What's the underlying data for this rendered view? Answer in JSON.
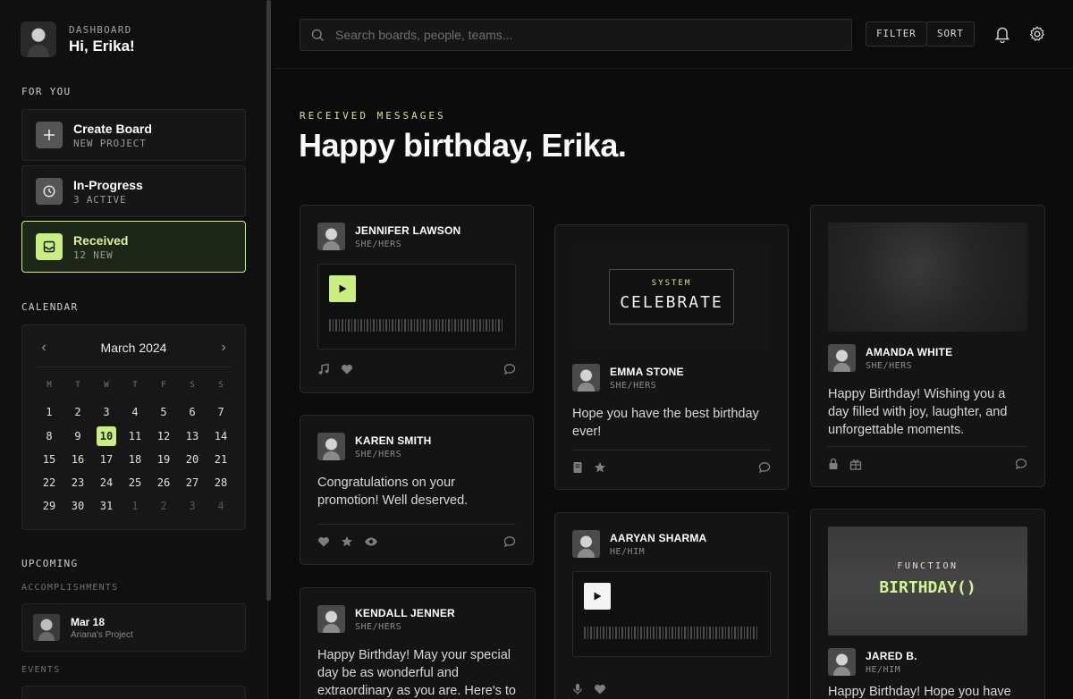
{
  "profile": {
    "kicker": "DASHBOARD",
    "greeting": "Hi, Erika!"
  },
  "sidebar": {
    "for_you_label": "FOR YOU",
    "nav": [
      {
        "title": "Create Board",
        "sub": "NEW PROJECT",
        "icon": "plus-icon"
      },
      {
        "title": "In-Progress",
        "sub": "3 ACTIVE",
        "icon": "clock-icon"
      },
      {
        "title": "Received",
        "sub": "12 NEW",
        "icon": "inbox-icon"
      }
    ],
    "calendar_label": "CALENDAR",
    "calendar": {
      "month": "March 2024",
      "dow": [
        "M",
        "T",
        "W",
        "T",
        "F",
        "S",
        "S"
      ],
      "days": [
        "1",
        "2",
        "3",
        "4",
        "5",
        "6",
        "7",
        "8",
        "9",
        "10",
        "11",
        "12",
        "13",
        "14",
        "15",
        "16",
        "17",
        "18",
        "19",
        "20",
        "21",
        "22",
        "23",
        "24",
        "25",
        "26",
        "27",
        "28",
        "29",
        "30",
        "31",
        "1",
        "2",
        "3",
        "4"
      ],
      "today": "10"
    },
    "upcoming_label": "UPCOMING",
    "accomplishments_label": "ACCOMPLISHMENTS",
    "accomplishment": {
      "date": "Mar 18",
      "sub": "Ariana's Project"
    },
    "events_label": "EVENTS"
  },
  "topbar": {
    "search_placeholder": "Search boards, people, teams...",
    "filter": "FILTER",
    "sort": "SORT"
  },
  "main": {
    "kicker": "RECEIVED MESSAGES",
    "headline": "Happy birthday, Erika."
  },
  "cards": {
    "jennifer": {
      "name": "JENNIFER LAWSON",
      "pron": "SHE/HERS"
    },
    "karen": {
      "name": "KAREN SMITH",
      "pron": "SHE/HERS",
      "msg": "Congratulations on your promotion! Well deserved."
    },
    "kendall": {
      "name": "KENDALL JENNER",
      "pron": "SHE/HERS",
      "msg": "Happy Birthday! May your special day be as wonderful and extraordinary as you are. Here's to"
    },
    "emma": {
      "name": "EMMA STONE",
      "pron": "SHE/HERS",
      "msg": "Hope you have the best birthday ever!",
      "media_kicker": "SYSTEM",
      "media_word": "CELEBRATE"
    },
    "aaryan": {
      "name": "AARYAN SHARMA",
      "pron": "HE/HIM"
    },
    "amanda": {
      "name": "AMANDA WHITE",
      "pron": "SHE/HERS",
      "msg": "Happy Birthday! Wishing you a day filled with joy, laughter, and unforgettable moments."
    },
    "jared": {
      "name": "JARED B.",
      "pron": "HE/HIM",
      "msg": "Happy Birthday! Hope you have",
      "media_kicker": "FUNCTION",
      "media_word": "BIRTHDAY()"
    }
  },
  "colors": {
    "accent": "#c9f07e",
    "background": "#0c0c0c",
    "card": "#141414"
  }
}
